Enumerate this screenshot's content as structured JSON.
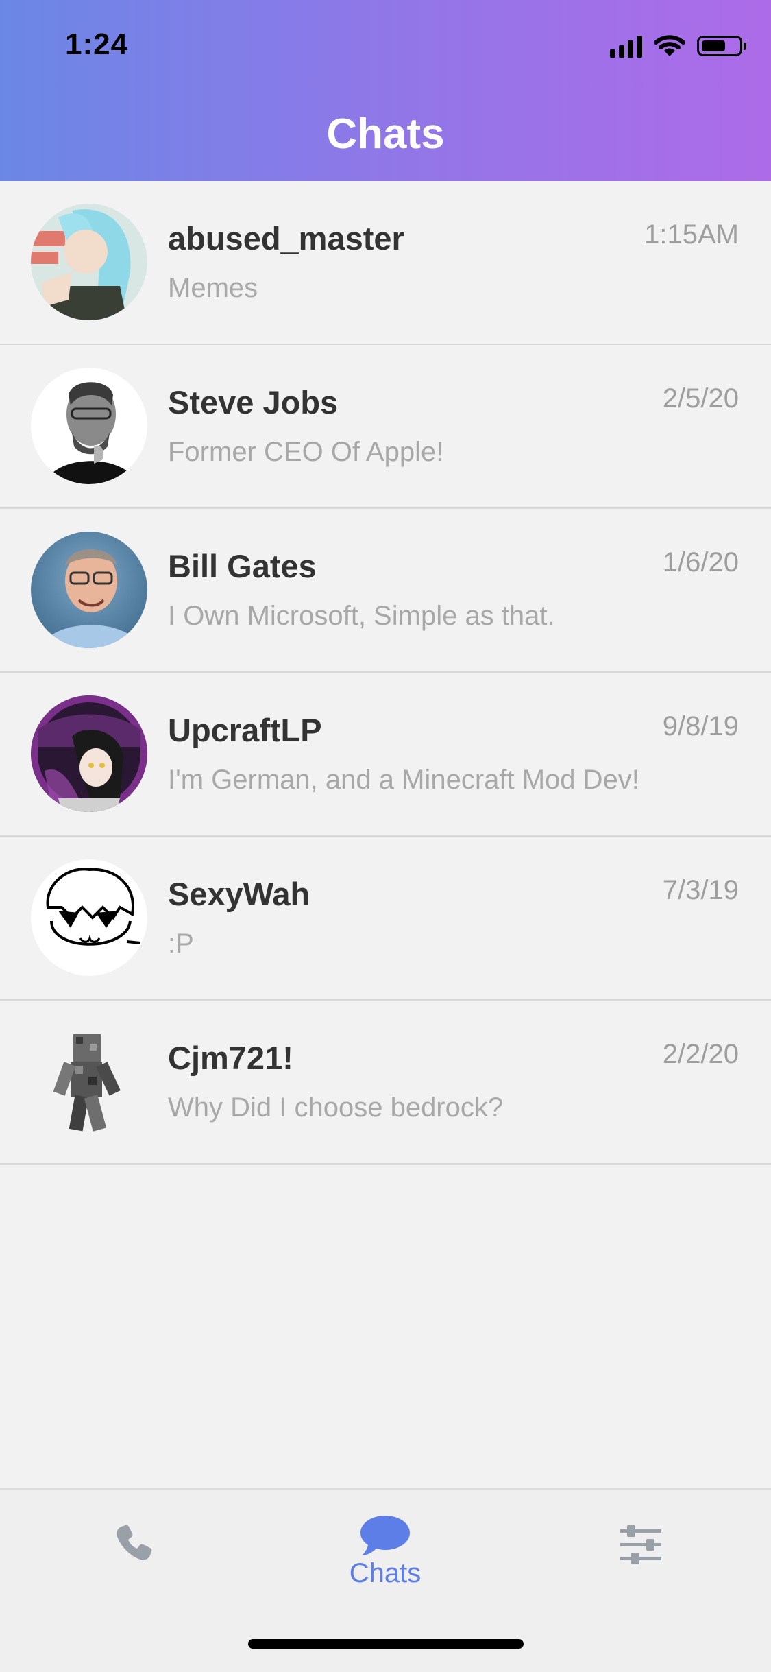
{
  "status_bar": {
    "time": "1:24",
    "icons": [
      "cellular-signal-icon",
      "wifi-icon",
      "battery-icon"
    ]
  },
  "header": {
    "title": "Chats",
    "gradient": [
      "#6b87e6",
      "#ad6be8"
    ]
  },
  "chats": [
    {
      "name": "abused_master",
      "preview": "Memes",
      "time": "1:15AM",
      "avatar": "anime-character-avatar"
    },
    {
      "name": "Steve Jobs",
      "preview": "Former CEO Of Apple!",
      "time": "2/5/20",
      "avatar": "portrait-photo-avatar"
    },
    {
      "name": "Bill Gates",
      "preview": "I Own Microsoft, Simple as that.",
      "time": "1/6/20",
      "avatar": "portrait-photo-avatar"
    },
    {
      "name": "UpcraftLP",
      "preview": "I'm German, and a Minecraft Mod Dev!",
      "time": "9/8/19",
      "avatar": "anime-character-avatar"
    },
    {
      "name": "SexyWah",
      "preview": ":P",
      "time": "7/3/19",
      "avatar": "cartoon-face-avatar"
    },
    {
      "name": "Cjm721!",
      "preview": "Why Did I choose bedrock?",
      "time": "2/2/20",
      "avatar": "minecraft-skin-avatar"
    }
  ],
  "tab_bar": {
    "tabs": [
      {
        "id": "calls",
        "label": "",
        "icon": "phone-icon",
        "active": false
      },
      {
        "id": "chats",
        "label": "Chats",
        "icon": "chat-bubble-icon",
        "active": true
      },
      {
        "id": "settings",
        "label": "",
        "icon": "sliders-icon",
        "active": false
      }
    ],
    "active_color": "#5d7ee6",
    "inactive_color": "#9aa0a8"
  }
}
